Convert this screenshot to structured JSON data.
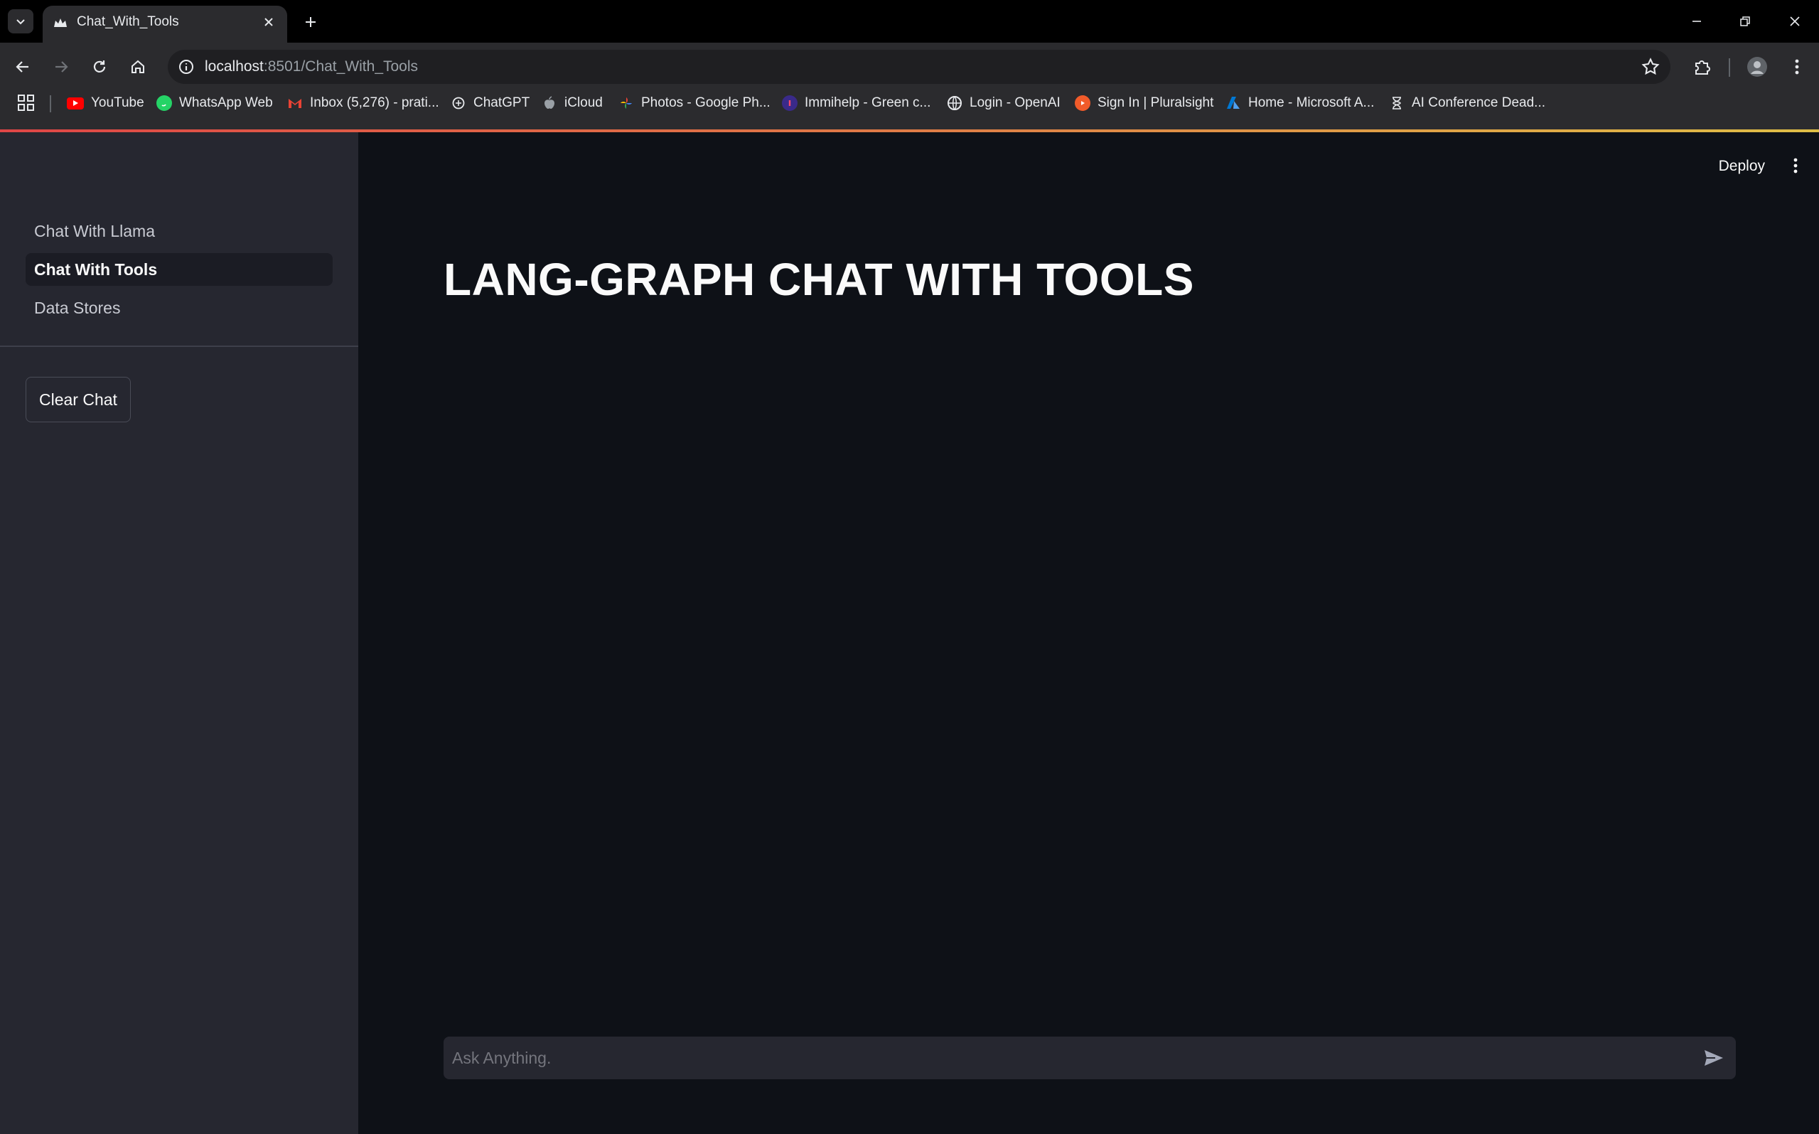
{
  "browser": {
    "tab_title": "Chat_With_Tools",
    "url_host": "localhost",
    "url_path": ":8501/Chat_With_Tools",
    "bookmarks": [
      {
        "label": "YouTube",
        "icon": "youtube-icon",
        "color": "#ff0000"
      },
      {
        "label": "WhatsApp Web",
        "icon": "whatsapp-icon",
        "color": "#25d366"
      },
      {
        "label": "Inbox (5,276) - prati...",
        "icon": "gmail-icon",
        "color": "#ea4335"
      },
      {
        "label": "ChatGPT",
        "icon": "chatgpt-icon",
        "color": "#e8eaed"
      },
      {
        "label": "iCloud",
        "icon": "apple-icon",
        "color": "#9aa0a6"
      },
      {
        "label": "Photos - Google Ph...",
        "icon": "google-photos-icon",
        "color": "#fbbc04"
      },
      {
        "label": "Immihelp - Green c...",
        "icon": "immihelp-icon",
        "color": "#6b4bd8"
      },
      {
        "label": "Login - OpenAI",
        "icon": "globe-icon",
        "color": "#e8eaed"
      },
      {
        "label": "Sign In | Pluralsight",
        "icon": "pluralsight-icon",
        "color": "#f15b2a"
      },
      {
        "label": "Home - Microsoft A...",
        "icon": "azure-icon",
        "color": "#0078d4"
      },
      {
        "label": "AI Conference Dead...",
        "icon": "hourglass-icon",
        "color": "#e8eaed"
      }
    ]
  },
  "sidebar": {
    "items": [
      {
        "label": "Chat With Llama",
        "active": false
      },
      {
        "label": "Chat With Tools",
        "active": true
      },
      {
        "label": "Data Stores",
        "active": false
      }
    ],
    "clear_button": "Clear Chat"
  },
  "header": {
    "deploy_label": "Deploy"
  },
  "main": {
    "title": "LANG-GRAPH CHAT WITH TOOLS",
    "chat_placeholder": "Ask Anything."
  },
  "colors": {
    "background": "#0e1117",
    "sidebar": "#262730",
    "accent": "#ff4b4b"
  }
}
